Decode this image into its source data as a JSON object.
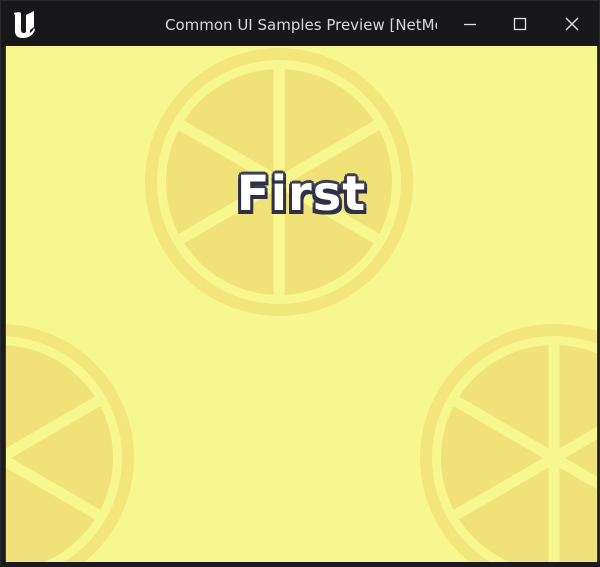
{
  "window": {
    "title": "Common UI Samples Preview [NetMode",
    "logo_icon": "unreal-engine-logo-icon",
    "controls": {
      "minimize_icon": "minimize-icon",
      "maximize_icon": "maximize-icon",
      "close_icon": "close-icon"
    }
  },
  "screen": {
    "title": "First",
    "background_color": "#f7f78f",
    "pattern_icon": "lemon-slice-icon",
    "pattern_color": "#f0e279"
  }
}
